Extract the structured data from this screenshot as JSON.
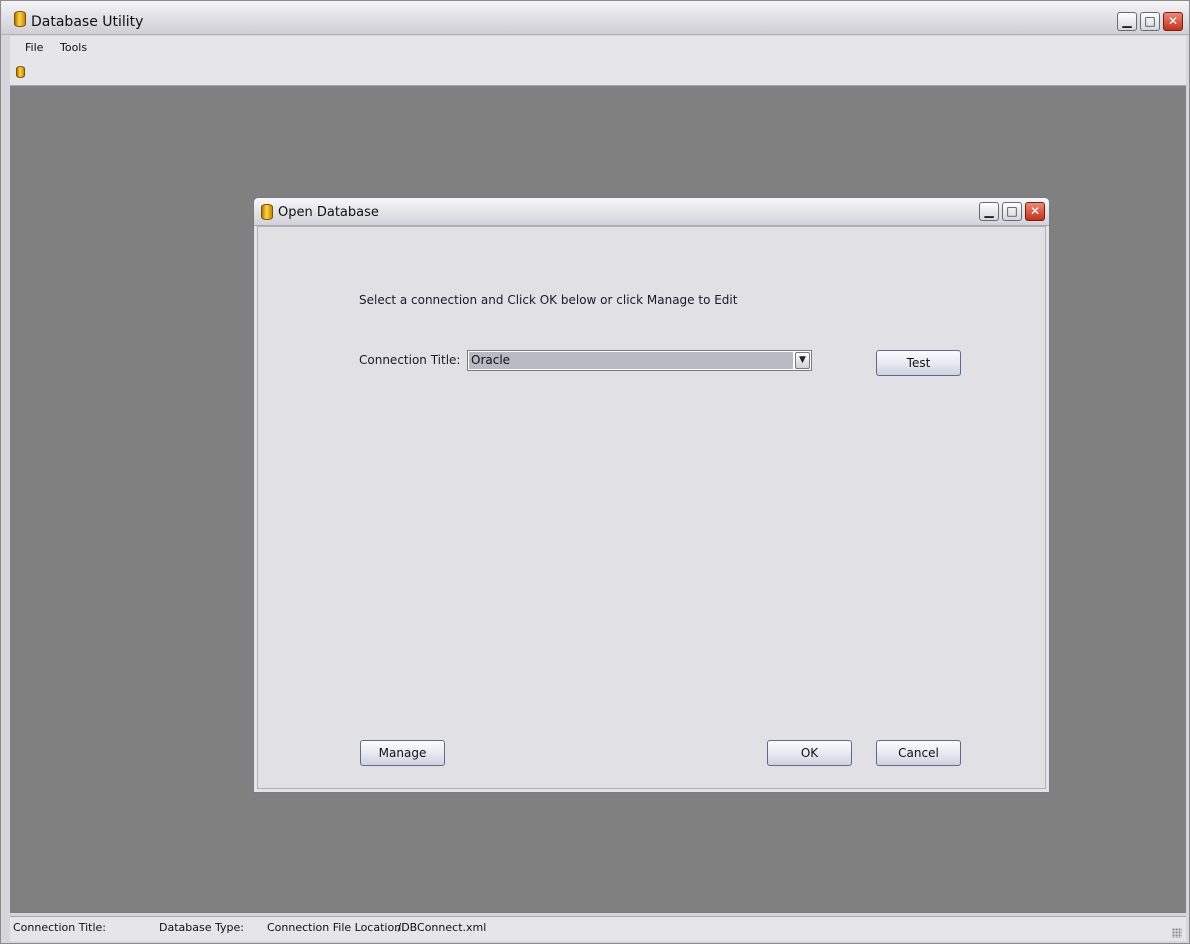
{
  "window": {
    "title": "Database Utility",
    "icon": "database-icon",
    "controls": [
      "minimize-icon",
      "maximize-icon",
      "close-icon"
    ]
  },
  "menu": {
    "items": [
      {
        "label": "File"
      },
      {
        "label": "Tools"
      }
    ]
  },
  "toolbar": {
    "icon": "database-icon"
  },
  "dialog": {
    "title": "Open Database",
    "icon": "database-icon",
    "instruction": "Select a connection and Click OK below or click Manage to Edit",
    "connection_label": "Connection Title:",
    "connection_value": "Oracle",
    "test_label": "Test",
    "manage_label": "Manage",
    "ok_label": "OK",
    "cancel_label": "Cancel"
  },
  "status": {
    "connection_title_label": "Connection Title:",
    "database_type_label": "Database Type:",
    "file_location_label": "Connection File Location:",
    "file_location_value": "./DBConnect.xml"
  },
  "colors": {
    "desktop": "#808080",
    "dialog_bg": "#e1e0e5",
    "close_button": "#c2321c"
  }
}
